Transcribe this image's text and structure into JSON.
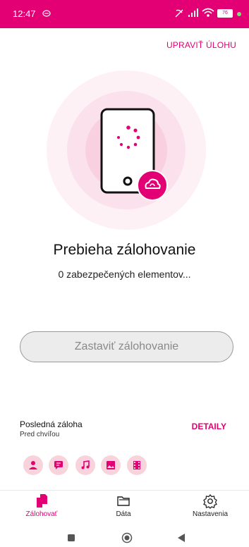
{
  "status_bar": {
    "time": "12:47",
    "battery": "76"
  },
  "header": {
    "edit_task_label": "UPRAVIŤ ÚLOHU"
  },
  "backup": {
    "title": "Prebieha zálohovanie",
    "subtitle": "0 zabezpečených elementov...",
    "stop_label": "Zastaviť zálohovanie"
  },
  "last_backup": {
    "label": "Posledná záloha",
    "time": "Pred chvíľou",
    "details_label": "DETAILY"
  },
  "categories": [
    "contacts-icon",
    "messages-icon",
    "music-icon",
    "photos-icon",
    "videos-icon"
  ],
  "bottom_nav": [
    {
      "label": "Zálohovať",
      "icon": "backup-icon",
      "active": true
    },
    {
      "label": "Dáta",
      "icon": "folder-icon",
      "active": false
    },
    {
      "label": "Nastavenia",
      "icon": "gear-icon",
      "active": false
    }
  ],
  "colors": {
    "accent": "#e20074",
    "ring_light": "#fdeef4",
    "chip_bg": "#f9d3dc"
  }
}
